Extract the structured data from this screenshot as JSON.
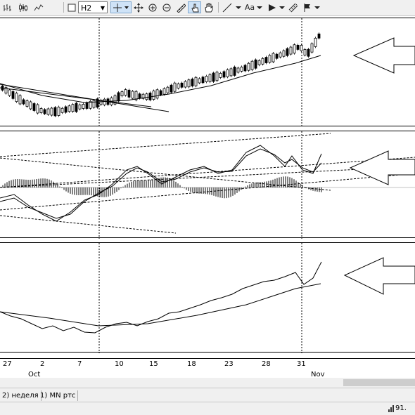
{
  "toolbar": {
    "timeframe": "H2",
    "font_label": "Aa",
    "icons": [
      "bar-chart-icon",
      "candles-icon",
      "line-chart-icon",
      "crosshair-icon",
      "move-icon",
      "zoom-in-icon",
      "zoom-out-icon",
      "ruler-icon",
      "hand-cursor-icon",
      "hand-icon",
      "line-tool-icon",
      "arrow-tool-icon",
      "flag-icon",
      "channel-tool-icon"
    ]
  },
  "axis": {
    "ticks": [
      "27",
      "2",
      "7",
      "10",
      "15",
      "18",
      "23",
      "28",
      "31"
    ],
    "months": [
      "Oct",
      "Nov"
    ]
  },
  "tabs": [
    "2) неделя",
    "1) MN ртс"
  ],
  "status": {
    "text": "91."
  },
  "colors": {
    "candle_up": "#ffffff",
    "candle_down": "#000000",
    "line": "#000000",
    "arrow_fill": "#ffffff"
  }
}
